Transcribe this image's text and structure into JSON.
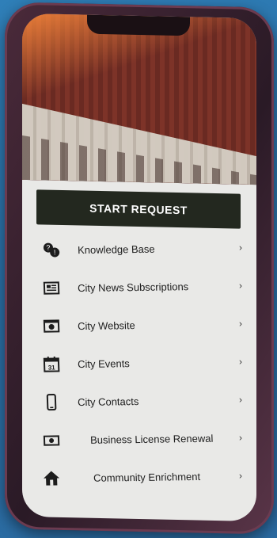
{
  "start_request": {
    "label": "START REQUEST"
  },
  "menu": {
    "items": [
      {
        "label": "Knowledge Base",
        "icon": "knowledge-base-icon"
      },
      {
        "label": "City News Subscriptions",
        "icon": "news-icon"
      },
      {
        "label": "City Website",
        "icon": "website-icon"
      },
      {
        "label": "City Events",
        "icon": "calendar-icon"
      },
      {
        "label": "City Contacts",
        "icon": "phone-icon"
      },
      {
        "label": "Business License Renewal",
        "icon": "license-icon"
      },
      {
        "label": "Community Enrichment",
        "icon": "home-icon"
      }
    ]
  },
  "calendar_day": "31"
}
